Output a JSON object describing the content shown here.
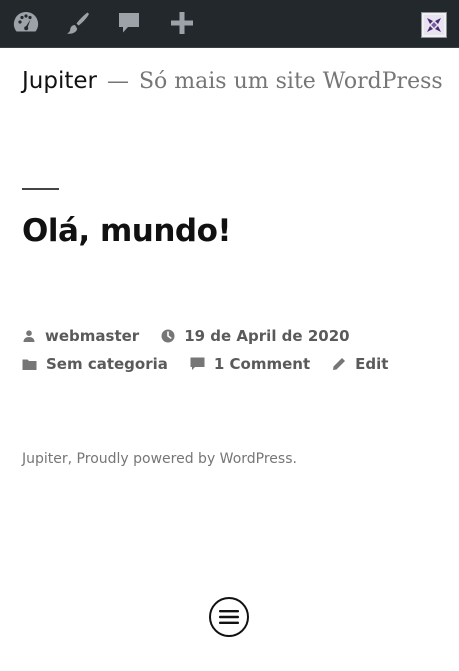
{
  "admin_bar": {
    "icons": [
      "dashboard-icon",
      "customize-brush-icon",
      "comments-icon",
      "new-content-plus-icon"
    ],
    "avatar_icon": "user-avatar-icon"
  },
  "site": {
    "title": "Jupiter",
    "separator": "—",
    "description": "Só mais um site WordPress"
  },
  "post": {
    "title": "Olá, mundo!",
    "author": "webmaster",
    "date": "19 de April de 2020",
    "category": "Sem categoria",
    "comments": "1 Comment",
    "edit": "Edit"
  },
  "footer": {
    "site_name": "Jupiter",
    "comma": ",",
    "powered_by": "Proudly powered by WordPress."
  },
  "colors": {
    "admin_bar_bg": "#23282d",
    "admin_icon": "#9ca2a7",
    "text_primary": "#111111",
    "text_secondary": "#767676",
    "avatar_accent": "#4b2a73"
  }
}
